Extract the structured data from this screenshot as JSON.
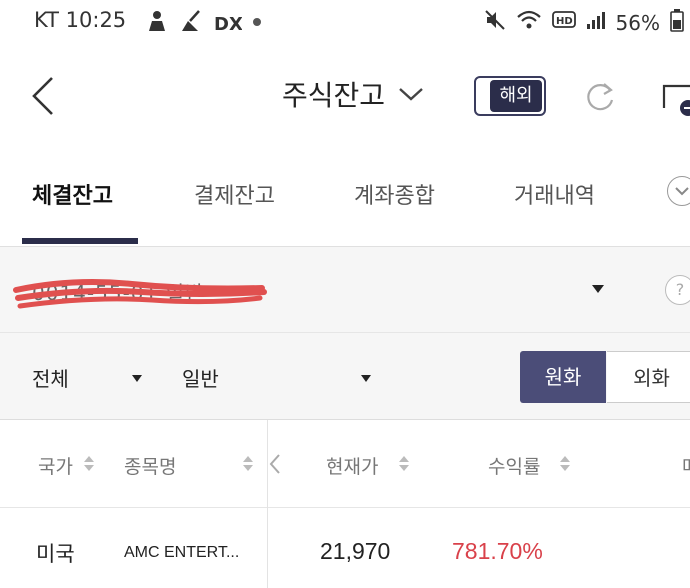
{
  "status_bar": {
    "carrier_time": "KT 10:25",
    "battery": "56%",
    "icons_left": [
      "person-icon",
      "broom-icon",
      "dx-icon",
      "dot-icon"
    ],
    "icons_right": [
      "mute-icon",
      "wifi-icon",
      "hd-icon",
      "signal-icon"
    ]
  },
  "header": {
    "title": "주식잔고",
    "toggle_label": "해외"
  },
  "tabs": [
    {
      "label": "체결잔고",
      "active": true
    },
    {
      "label": "결제잔고",
      "active": false
    },
    {
      "label": "계좌종합",
      "active": false
    },
    {
      "label": "거래내역",
      "active": false
    }
  ],
  "account": {
    "number": "0014-55-01 일반"
  },
  "filters": {
    "scope": "전체",
    "type": "일반",
    "currency_on": "원화",
    "currency_off": "외화"
  },
  "table": {
    "headers": {
      "country": "국가",
      "name": "종목명",
      "price": "현재가",
      "return": "수익률",
      "cut": "매"
    },
    "rows": [
      {
        "country": "미국",
        "name": "AMC ENTERT...",
        "price": "21,970",
        "return": "781.70%"
      }
    ]
  },
  "colors": {
    "accent": "#2b2d4a",
    "segment_active": "#4b4d78",
    "positive": "#d9414a",
    "redaction": "#e0504f"
  }
}
